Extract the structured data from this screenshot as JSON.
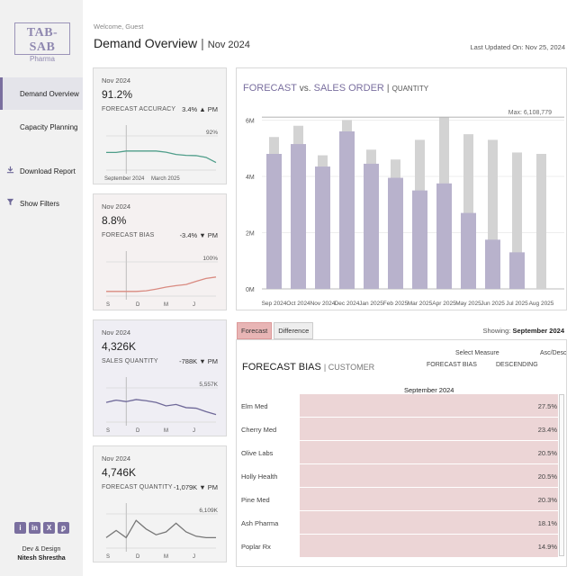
{
  "sidebar": {
    "logo_main": "TAB-SAB",
    "logo_sub": "Pharma",
    "nav": [
      {
        "label": "Demand Overview",
        "active": true
      },
      {
        "label": "Capacity Planning",
        "active": false
      }
    ],
    "download_label": "Download Report",
    "filters_label": "Show Filters",
    "social": [
      "i",
      "in",
      "X",
      "ꝑ"
    ],
    "credit_line1": "Dev & Design",
    "credit_line2": "Nitesh Shrestha"
  },
  "header": {
    "welcome": "Welcome, Guest",
    "title": "Demand Overview",
    "period": "Nov 2024",
    "updated": "Last Updated On: Nov 25, 2024"
  },
  "kpis": [
    {
      "period": "Nov 2024",
      "value": "91.2%",
      "label": "FORECAST ACCURACY",
      "delta": "3.4% ▲ PM",
      "max_label": "92%",
      "x_labels": [
        "September 2024",
        "March 2025"
      ],
      "color": "#4f9e8a",
      "trend": [
        0.55,
        0.55,
        0.6,
        0.6,
        0.6,
        0.6,
        0.56,
        0.48,
        0.45,
        0.44,
        0.38,
        0.2
      ]
    },
    {
      "period": "Nov 2024",
      "value": "8.8%",
      "label": "FORECAST BIAS",
      "delta": "-3.4% ▼ PM",
      "max_label": "100%",
      "x_labels": [
        "S",
        "D",
        "M",
        "J"
      ],
      "color": "#d98a80",
      "trend": [
        0.1,
        0.1,
        0.1,
        0.1,
        0.12,
        0.18,
        0.25,
        0.3,
        0.34,
        0.45,
        0.55,
        0.6
      ]
    },
    {
      "period": "Nov 2024",
      "value": "4,326K",
      "label": "SALES QUANTITY",
      "delta": "-788K ▼ PM",
      "max_label": "5,557K",
      "x_labels": [
        "S",
        "D",
        "M",
        "J"
      ],
      "color": "#6e6898",
      "trend": [
        0.62,
        0.7,
        0.65,
        0.72,
        0.68,
        0.62,
        0.5,
        0.55,
        0.44,
        0.42,
        0.3,
        0.2
      ]
    },
    {
      "period": "Nov 2024",
      "value": "4,746K",
      "label": "FORECAST QUANTITY",
      "delta": "-1,079K ▼ PM",
      "max_label": "6,109K",
      "x_labels": [
        "S",
        "D",
        "M",
        "J"
      ],
      "color": "#777777",
      "trend": [
        0.3,
        0.55,
        0.3,
        0.9,
        0.6,
        0.4,
        0.5,
        0.8,
        0.5,
        0.35,
        0.3,
        0.3
      ]
    }
  ],
  "forecast_chart": {
    "title_a": "FORECAST",
    "title_vs": "vs.",
    "title_b": "SALES ORDER",
    "title_unit": "QUANTITY",
    "max_note": "Max: 6,108,779",
    "colors": {
      "forecast": "#d3d3d3",
      "sales": "#b8b2cc"
    }
  },
  "chart_data": {
    "type": "bar",
    "categories": [
      "Sep 2024",
      "Oct 2024",
      "Nov 2024",
      "Dec 2024",
      "Jan 2025",
      "Feb 2025",
      "Mar 2025",
      "Apr 2025",
      "May 2025",
      "Jun 2025",
      "Jul 2025",
      "Aug 2025"
    ],
    "series": [
      {
        "name": "Forecast",
        "values": [
          5.4,
          5.8,
          4.75,
          6.0,
          4.95,
          4.6,
          5.3,
          6.1,
          5.5,
          5.3,
          4.85,
          4.8
        ]
      },
      {
        "name": "Sales Order",
        "values": [
          4.8,
          5.15,
          4.35,
          5.6,
          4.45,
          3.95,
          3.5,
          3.75,
          2.7,
          1.75,
          1.3,
          0
        ]
      }
    ],
    "y_ticks": [
      "0M",
      "2M",
      "4M",
      "6M"
    ],
    "ylim": [
      0,
      6.4
    ]
  },
  "tabs": [
    "Forecast",
    "Difference"
  ],
  "showing_label": "Showing:",
  "showing_value": "September 2024",
  "bias_table": {
    "title": "FORECAST BIAS",
    "subtitle": "CUSTOMER",
    "select_label": "Select Measure",
    "select_value": "FORECAST BIAS",
    "sort_label": "Asc/Desc",
    "sort_value": "DESCENDING",
    "column": "September 2024",
    "rows": [
      {
        "name": "Elm Med",
        "value": "27.5%"
      },
      {
        "name": "Cherry Med",
        "value": "23.4%"
      },
      {
        "name": "Olive Labs",
        "value": "20.5%"
      },
      {
        "name": "Holly Health",
        "value": "20.5%"
      },
      {
        "name": "Pine Med",
        "value": "20.3%"
      },
      {
        "name": "Ash Pharma",
        "value": "18.1%"
      },
      {
        "name": "Poplar Rx",
        "value": "14.9%"
      }
    ]
  }
}
